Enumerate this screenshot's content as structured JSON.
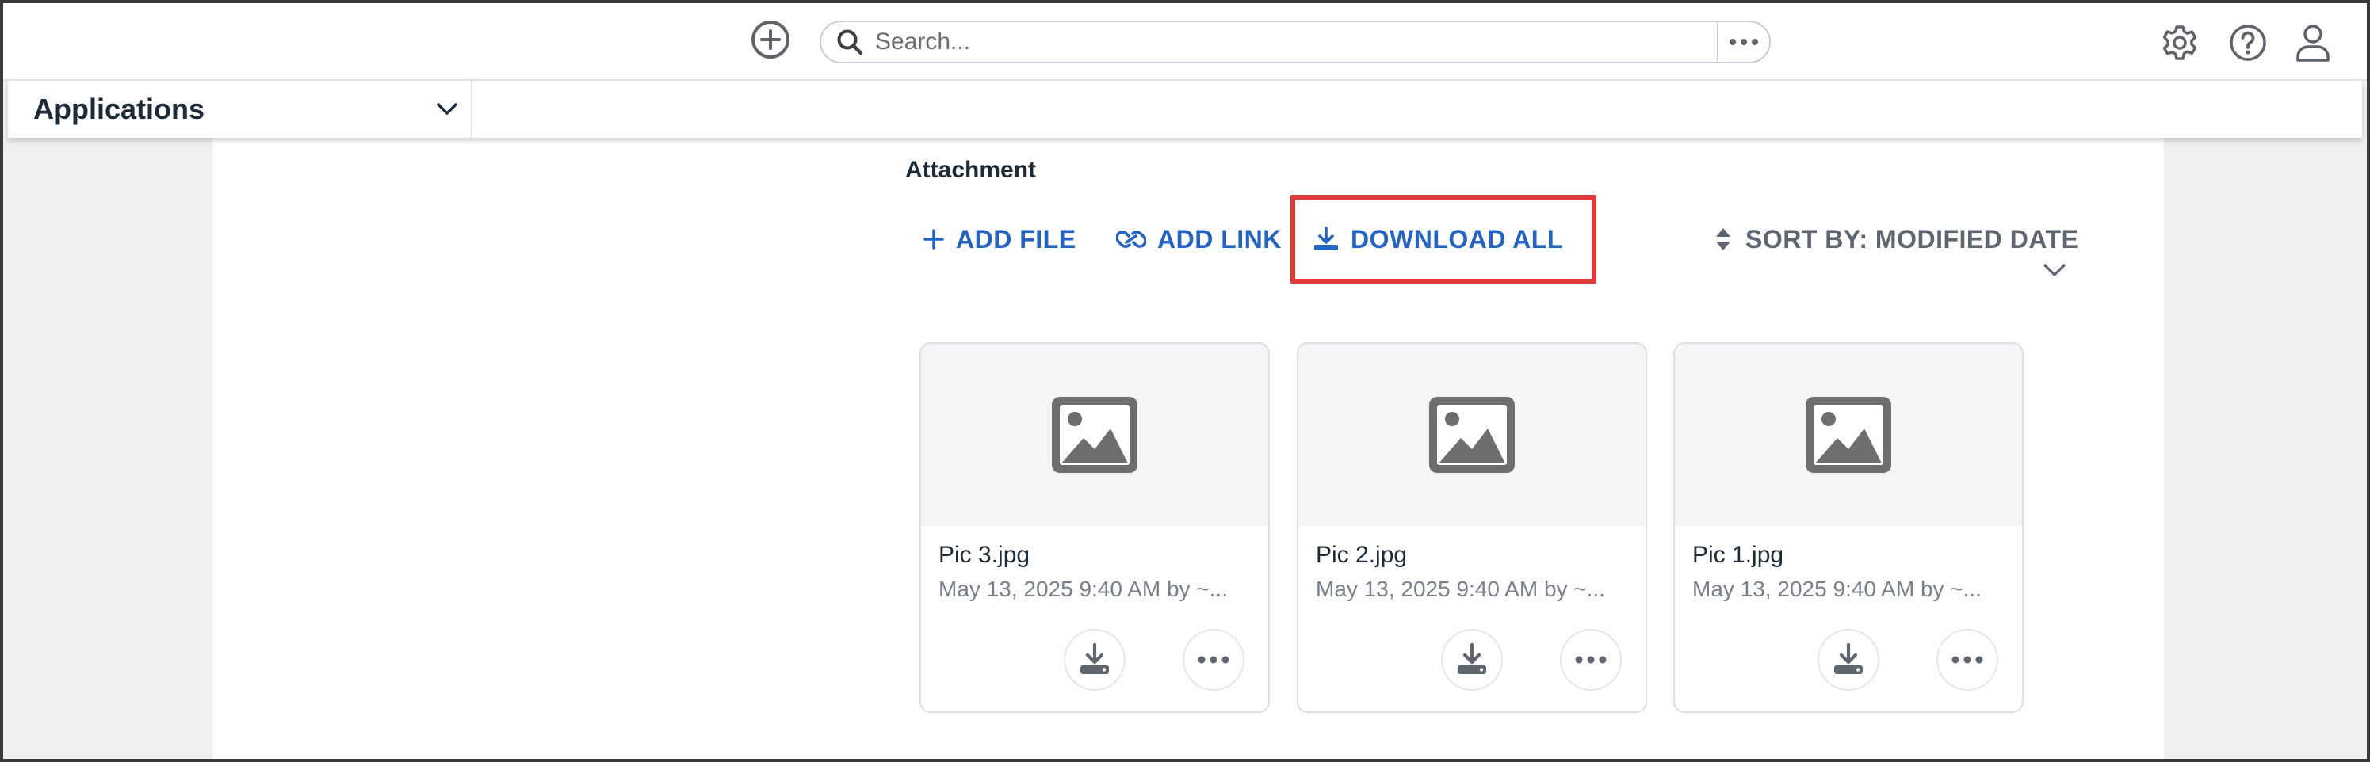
{
  "search": {
    "placeholder": "Search..."
  },
  "app_selector": {
    "label": "Applications"
  },
  "section": {
    "title": "Attachment"
  },
  "actions": {
    "add_file": "ADD FILE",
    "add_link": "ADD LINK",
    "download_all": "DOWNLOAD ALL",
    "sort": "SORT BY: MODIFIED DATE"
  },
  "attachments": [
    {
      "name": "Pic 3.jpg",
      "meta": "May 13, 2025 9:40 AM by ~..."
    },
    {
      "name": "Pic 2.jpg",
      "meta": "May 13, 2025 9:40 AM by ~..."
    },
    {
      "name": "Pic 1.jpg",
      "meta": "May 13, 2025 9:40 AM by ~..."
    }
  ],
  "icons": {
    "add": "plus-circle-icon",
    "search": "magnifier-icon",
    "more": "ellipsis-icon",
    "settings": "gear-icon",
    "help": "question-circle-icon",
    "user": "user-icon",
    "image": "image-icon",
    "download": "download-icon",
    "sort": "sort-arrows-icon",
    "link": "link-icon"
  },
  "colors": {
    "accent": "#2463c6",
    "highlight": "#e23a3a",
    "icon_gray": "#6e6e70"
  }
}
